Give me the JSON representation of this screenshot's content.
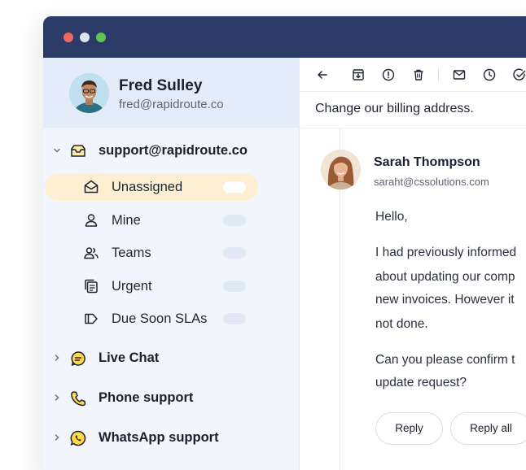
{
  "window": {
    "traffic_lights": {
      "close": "#ee6a5f",
      "minimize": "#f5bf4f",
      "maximize": "#61c554"
    },
    "titlebar_color": "#2b3a66"
  },
  "profile": {
    "name": "Fred Sulley",
    "email": "fred@rapidroute.co"
  },
  "sidebar": {
    "groups": [
      {
        "label": "support@rapidroute.co",
        "icon": "inbox-icon",
        "expanded": true
      },
      {
        "label": "Live Chat",
        "icon": "chat-bubble-icon",
        "expanded": false
      },
      {
        "label": "Phone support",
        "icon": "phone-icon",
        "expanded": false
      },
      {
        "label": "WhatsApp support",
        "icon": "whatsapp-icon",
        "expanded": false
      }
    ],
    "items": [
      {
        "label": "Unassigned",
        "icon": "envelope-open-icon",
        "active": true
      },
      {
        "label": "Mine",
        "icon": "user-icon",
        "active": false
      },
      {
        "label": "Teams",
        "icon": "users-icon",
        "active": false
      },
      {
        "label": "Urgent",
        "icon": "stacked-documents-icon",
        "active": false
      },
      {
        "label": "Due Soon SLAs",
        "icon": "tag-icon",
        "active": false
      }
    ],
    "accent_color": "#fcefd2"
  },
  "toolbar": {
    "icons": [
      "arrow-left-icon",
      "archive-icon",
      "alert-circle-icon",
      "trash-icon",
      "mail-icon",
      "clock-icon",
      "check-circle-icon"
    ]
  },
  "conversation": {
    "subject": "Change our billing address.",
    "sender": {
      "name": "Sarah Thompson",
      "email": "saraht@cssolutions.com"
    },
    "body_lines": [
      "Hello,",
      "I had previously informed",
      "about updating our comp",
      "new invoices. However it",
      "not done.",
      "Can you please confirm t",
      "update request?"
    ],
    "actions": {
      "reply_label": "Reply",
      "reply_all_label": "Reply all"
    }
  }
}
